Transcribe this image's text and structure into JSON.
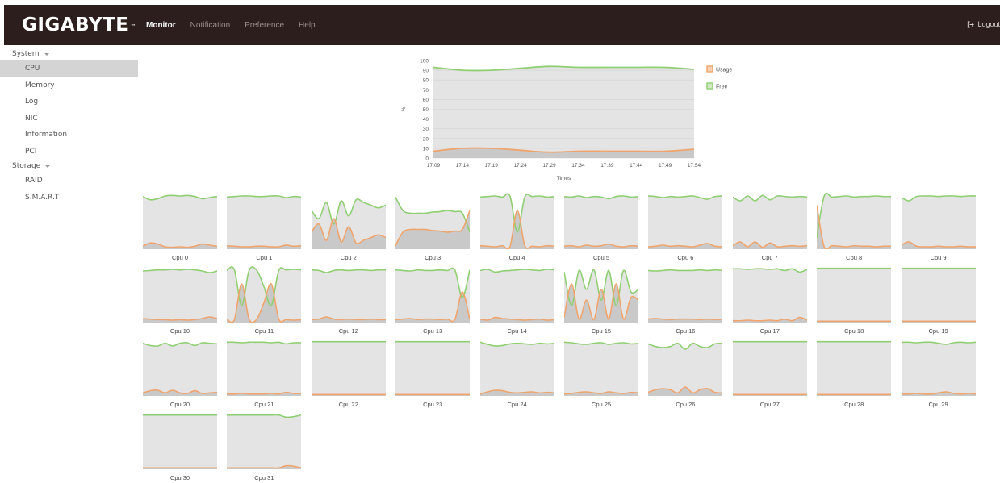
{
  "header": {
    "logo": "GIGABYTE",
    "logo_tm": "™",
    "nav": [
      {
        "label": "Monitor",
        "active": true
      },
      {
        "label": "Notification",
        "active": false
      },
      {
        "label": "Preference",
        "active": false
      },
      {
        "label": "Help",
        "active": false
      }
    ],
    "logout_label": "Logout"
  },
  "sidebar": {
    "groups": [
      {
        "label": "System",
        "items": [
          "CPU",
          "Memory",
          "Log",
          "NIC",
          "Information",
          "PCI"
        ]
      },
      {
        "label": "Storage",
        "items": [
          "RAID",
          "S.M.A.R.T"
        ]
      }
    ],
    "active_item": "CPU"
  },
  "colors": {
    "usage": "#f0a46b",
    "free": "#8fcf72",
    "fill_free": "#e4e4e4",
    "fill_usage": "#c9c9c9",
    "header_bg": "#2b1e1c"
  },
  "chart_data": {
    "type": "area",
    "xlabel": "Times",
    "ylabel": "%",
    "ylim": [
      0,
      100
    ],
    "yticks": [
      0,
      10,
      20,
      30,
      40,
      50,
      60,
      70,
      80,
      90,
      100
    ],
    "categories": [
      "17:09",
      "17:14",
      "17:19",
      "17:24",
      "17:29",
      "17:34",
      "17:39",
      "17:44",
      "17:49",
      "17:54"
    ],
    "series": [
      {
        "name": "Usage",
        "values": [
          7,
          10,
          10,
          8,
          6,
          7,
          7,
          7,
          7,
          9
        ]
      },
      {
        "name": "Free",
        "values": [
          93,
          90,
          90,
          92,
          94,
          93,
          93,
          93,
          93,
          91
        ]
      }
    ],
    "legend_position": "right"
  },
  "cpus": [
    {
      "label": "Cpu 0",
      "usage": [
        4,
        10,
        8,
        3,
        2,
        3,
        2,
        4,
        8,
        6,
        4
      ]
    },
    {
      "label": "Cpu 1",
      "usage": [
        5,
        4,
        3,
        3,
        4,
        4,
        3,
        3,
        6,
        4,
        5
      ]
    },
    {
      "label": "Cpu 2",
      "usage": [
        30,
        45,
        15,
        55,
        12,
        40,
        10,
        15,
        20,
        25,
        20
      ]
    },
    {
      "label": "Cpu 3",
      "usage": [
        5,
        30,
        35,
        35,
        35,
        33,
        32,
        30,
        32,
        35,
        70
      ]
    },
    {
      "label": "Cpu 4",
      "usage": [
        5,
        4,
        3,
        5,
        3,
        70,
        5,
        4,
        3,
        5,
        4
      ]
    },
    {
      "label": "Cpu 5",
      "usage": [
        4,
        5,
        3,
        6,
        4,
        5,
        8,
        4,
        3,
        5,
        4
      ]
    },
    {
      "label": "Cpu 6",
      "usage": [
        3,
        4,
        6,
        4,
        5,
        4,
        3,
        6,
        9,
        4,
        3
      ]
    },
    {
      "label": "Cpu 7",
      "usage": [
        5,
        12,
        3,
        12,
        2,
        10,
        3,
        4,
        5,
        4,
        5
      ]
    },
    {
      "label": "Cpu 8",
      "usage": [
        80,
        3,
        5,
        4,
        3,
        5,
        4,
        4,
        3,
        4,
        4
      ]
    },
    {
      "label": "Cpu 9",
      "usage": [
        6,
        12,
        4,
        3,
        3,
        4,
        3,
        3,
        4,
        3,
        3
      ]
    },
    {
      "label": "Cpu 10",
      "usage": [
        6,
        5,
        4,
        4,
        3,
        4,
        3,
        4,
        6,
        9,
        6
      ]
    },
    {
      "label": "Cpu 11",
      "usage": [
        5,
        3,
        70,
        5,
        4,
        35,
        70,
        5,
        4,
        3,
        4
      ]
    },
    {
      "label": "Cpu 12",
      "usage": [
        4,
        5,
        9,
        5,
        4,
        5,
        4,
        4,
        5,
        4,
        4
      ]
    },
    {
      "label": "Cpu 13",
      "usage": [
        4,
        5,
        6,
        4,
        5,
        5,
        4,
        5,
        4,
        55,
        4
      ]
    },
    {
      "label": "Cpu 14",
      "usage": [
        5,
        3,
        8,
        6,
        5,
        4,
        3,
        4,
        5,
        3,
        4
      ]
    },
    {
      "label": "Cpu 15",
      "usage": [
        8,
        70,
        5,
        40,
        4,
        60,
        5,
        70,
        5,
        45,
        40
      ]
    },
    {
      "label": "Cpu 16",
      "usage": [
        5,
        6,
        5,
        4,
        5,
        5,
        5,
        4,
        5,
        4,
        5
      ]
    },
    {
      "label": "Cpu 17",
      "usage": [
        2,
        2,
        3,
        2,
        2,
        3,
        2,
        5,
        2,
        8,
        3
      ]
    },
    {
      "label": "Cpu 18",
      "usage": [
        1,
        1,
        1,
        1,
        1,
        1,
        1,
        1,
        1,
        1,
        1
      ]
    },
    {
      "label": "Cpu 19",
      "usage": [
        1,
        1,
        1,
        1,
        1,
        1,
        1,
        1,
        1,
        1,
        1
      ]
    },
    {
      "label": "Cpu 20",
      "usage": [
        4,
        8,
        9,
        4,
        9,
        4,
        3,
        8,
        3,
        4,
        5
      ]
    },
    {
      "label": "Cpu 21",
      "usage": [
        2,
        2,
        3,
        2,
        2,
        2,
        3,
        2,
        5,
        3,
        3
      ]
    },
    {
      "label": "Cpu 22",
      "usage": [
        1,
        1,
        1,
        1,
        1,
        1,
        1,
        1,
        1,
        1,
        1
      ]
    },
    {
      "label": "Cpu 23",
      "usage": [
        1,
        1,
        1,
        1,
        1,
        1,
        1,
        1,
        1,
        1,
        1
      ]
    },
    {
      "label": "Cpu 24",
      "usage": [
        2,
        6,
        9,
        8,
        5,
        4,
        5,
        6,
        4,
        5,
        4
      ]
    },
    {
      "label": "Cpu 25",
      "usage": [
        2,
        3,
        5,
        6,
        4,
        3,
        6,
        4,
        3,
        5,
        4
      ]
    },
    {
      "label": "Cpu 26",
      "usage": [
        5,
        10,
        12,
        10,
        4,
        15,
        4,
        10,
        12,
        5,
        4
      ]
    },
    {
      "label": "Cpu 27",
      "usage": [
        1,
        1,
        1,
        1,
        1,
        1,
        1,
        1,
        1,
        1,
        1
      ]
    },
    {
      "label": "Cpu 28",
      "usage": [
        1,
        1,
        1,
        1,
        1,
        1,
        1,
        1,
        1,
        1,
        1
      ]
    },
    {
      "label": "Cpu 29",
      "usage": [
        2,
        2,
        3,
        2,
        2,
        4,
        6,
        3,
        2,
        3,
        2
      ]
    },
    {
      "label": "Cpu 30",
      "usage": [
        1,
        1,
        1,
        1,
        1,
        1,
        1,
        1,
        1,
        1,
        1
      ]
    },
    {
      "label": "Cpu 31",
      "usage": [
        1,
        1,
        1,
        1,
        1,
        1,
        1,
        1,
        5,
        4,
        1
      ]
    }
  ]
}
